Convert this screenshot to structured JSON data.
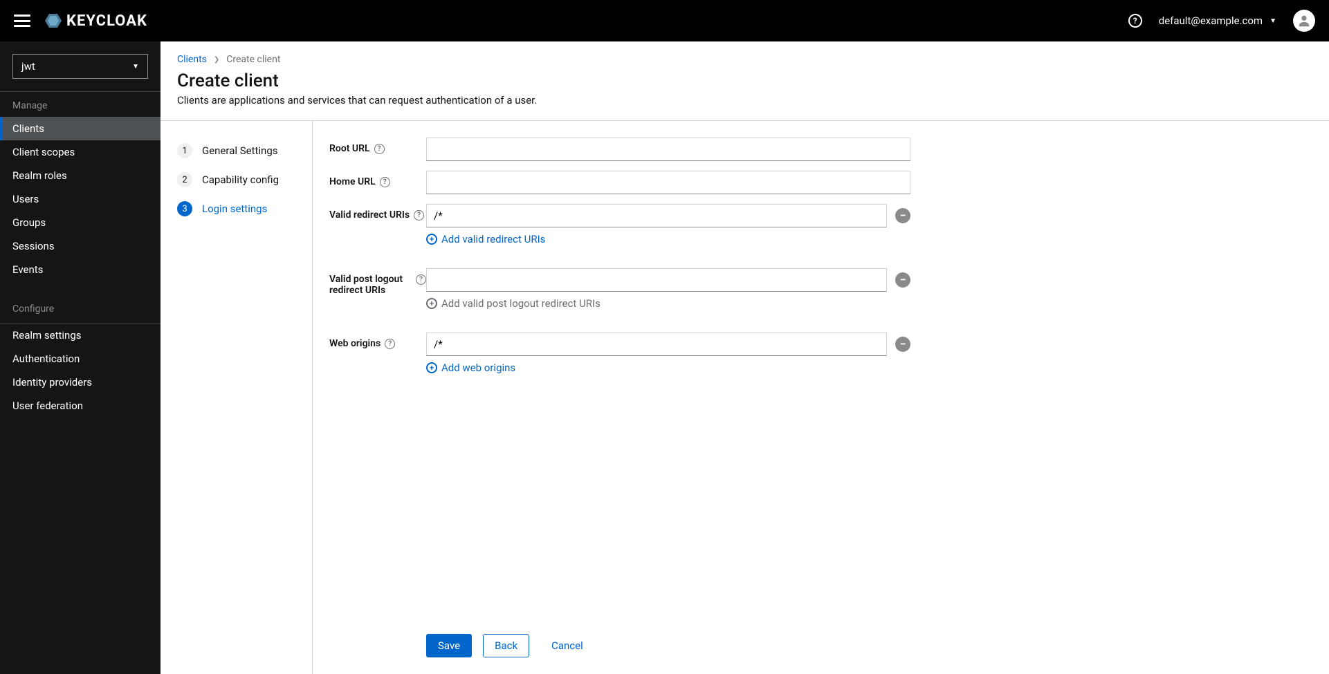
{
  "header": {
    "logo_text": "KEYCLOAK",
    "user_email": "default@example.com"
  },
  "sidebar": {
    "realm": "jwt",
    "sections": [
      {
        "title": "Manage",
        "items": [
          "Clients",
          "Client scopes",
          "Realm roles",
          "Users",
          "Groups",
          "Sessions",
          "Events"
        ]
      },
      {
        "title": "Configure",
        "items": [
          "Realm settings",
          "Authentication",
          "Identity providers",
          "User federation"
        ]
      }
    ],
    "active": "Clients"
  },
  "breadcrumb": {
    "parent": "Clients",
    "current": "Create client"
  },
  "page": {
    "title": "Create client",
    "description": "Clients are applications and services that can request authentication of a user."
  },
  "wizard": {
    "steps": [
      {
        "num": "1",
        "label": "General Settings"
      },
      {
        "num": "2",
        "label": "Capability config"
      },
      {
        "num": "3",
        "label": "Login settings"
      }
    ],
    "active": 3
  },
  "form": {
    "root_url": {
      "label": "Root URL",
      "value": ""
    },
    "home_url": {
      "label": "Home URL",
      "value": ""
    },
    "redirect_uris": {
      "label": "Valid redirect URIs",
      "value": "/*",
      "add_label": "Add valid redirect URIs"
    },
    "post_logout": {
      "label": "Valid post logout redirect URIs",
      "value": "",
      "add_label": "Add valid post logout redirect URIs"
    },
    "web_origins": {
      "label": "Web origins",
      "value": "/*",
      "add_label": "Add web origins"
    }
  },
  "actions": {
    "save": "Save",
    "back": "Back",
    "cancel": "Cancel"
  }
}
